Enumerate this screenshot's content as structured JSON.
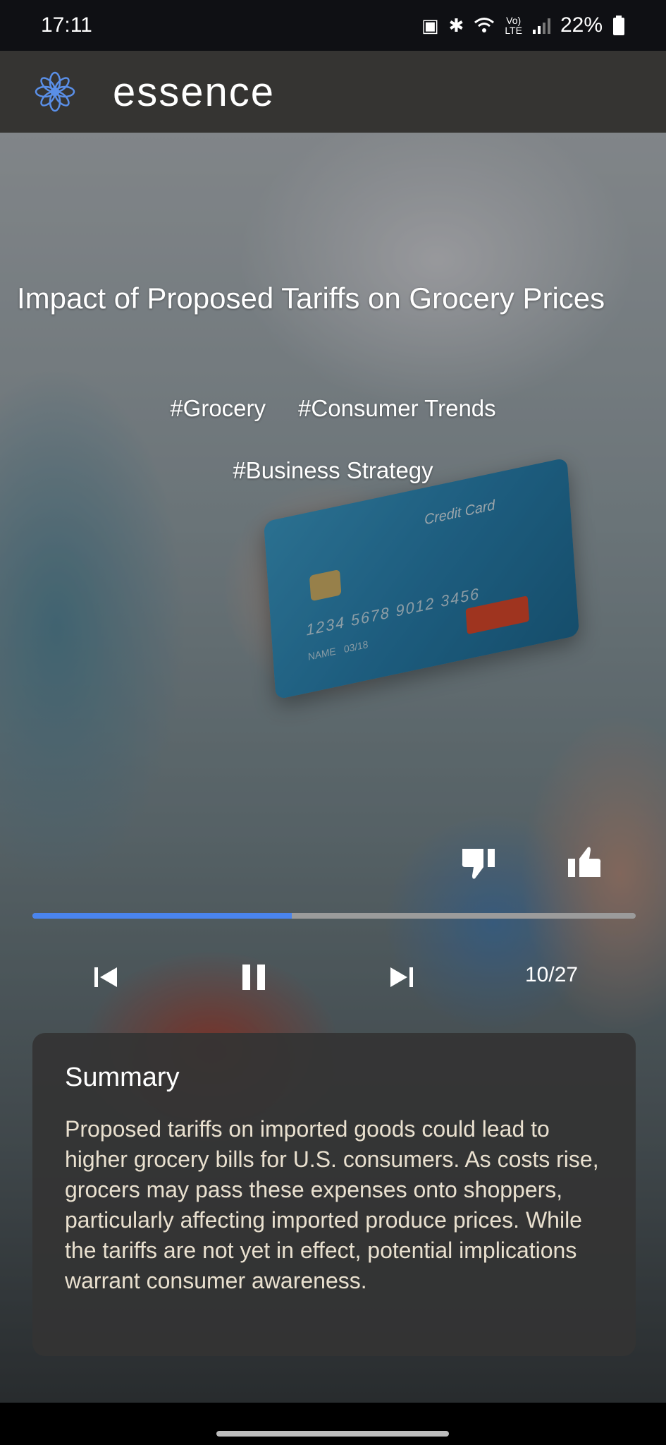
{
  "status_bar": {
    "time": "17:11",
    "battery": "22%",
    "icons": [
      "save-data-icon",
      "bluetooth-icon",
      "wifi-icon",
      "volte-icon",
      "signal-icon",
      "battery-icon"
    ]
  },
  "app": {
    "title": "essence",
    "brand_color": "#4a84ee"
  },
  "article": {
    "title": "Impact of Proposed Tariffs on Grocery Prices",
    "tags_row1": [
      "#Grocery",
      "#Consumer Trends"
    ],
    "tags_row2": [
      "#Business Strategy"
    ],
    "background_card": {
      "label": "Credit Card",
      "number": "1234 5678 9012 3456",
      "name": "NAME",
      "expiry": "03/18"
    }
  },
  "player": {
    "progress_fraction": 0.43,
    "counter": "10/27",
    "progress_fill_color": "#4a84ee",
    "progress_track_color": "#9b9b9b"
  },
  "summary": {
    "title": "Summary",
    "text": "Proposed tariffs on imported goods could lead to higher grocery bills for U.S. consumers. As costs rise, grocers may pass these expenses onto shoppers, particularly affecting imported produce prices. While the tariffs are not yet in effect, potential implications warrant consumer awareness."
  }
}
